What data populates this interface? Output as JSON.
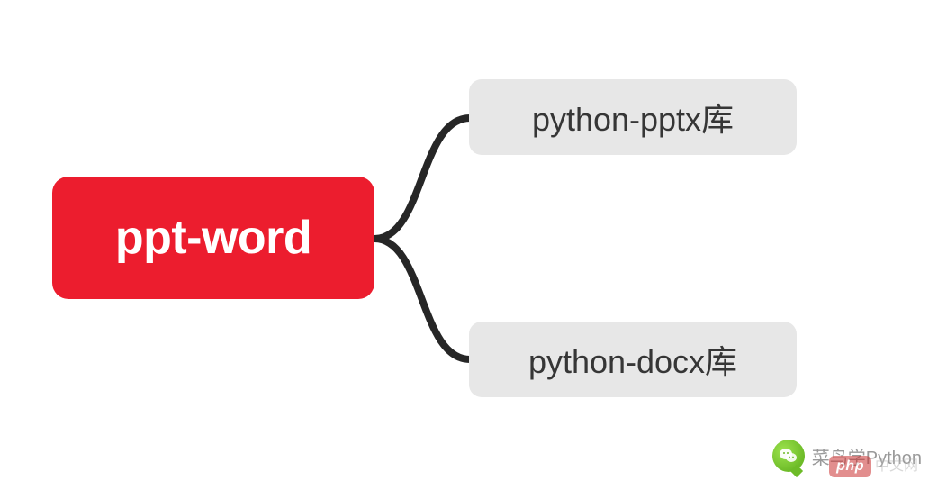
{
  "mindmap": {
    "root": {
      "label": "ppt-word",
      "color": "#EC1D2E"
    },
    "children": [
      {
        "label": "python-pptx库"
      },
      {
        "label": "python-docx库"
      }
    ],
    "child_bg": "#E7E7E7",
    "connector_color": "#262626"
  },
  "watermarks": {
    "wechat_label": "菜鸟学Python",
    "php_badge": "php",
    "php_suffix": "中文网"
  }
}
